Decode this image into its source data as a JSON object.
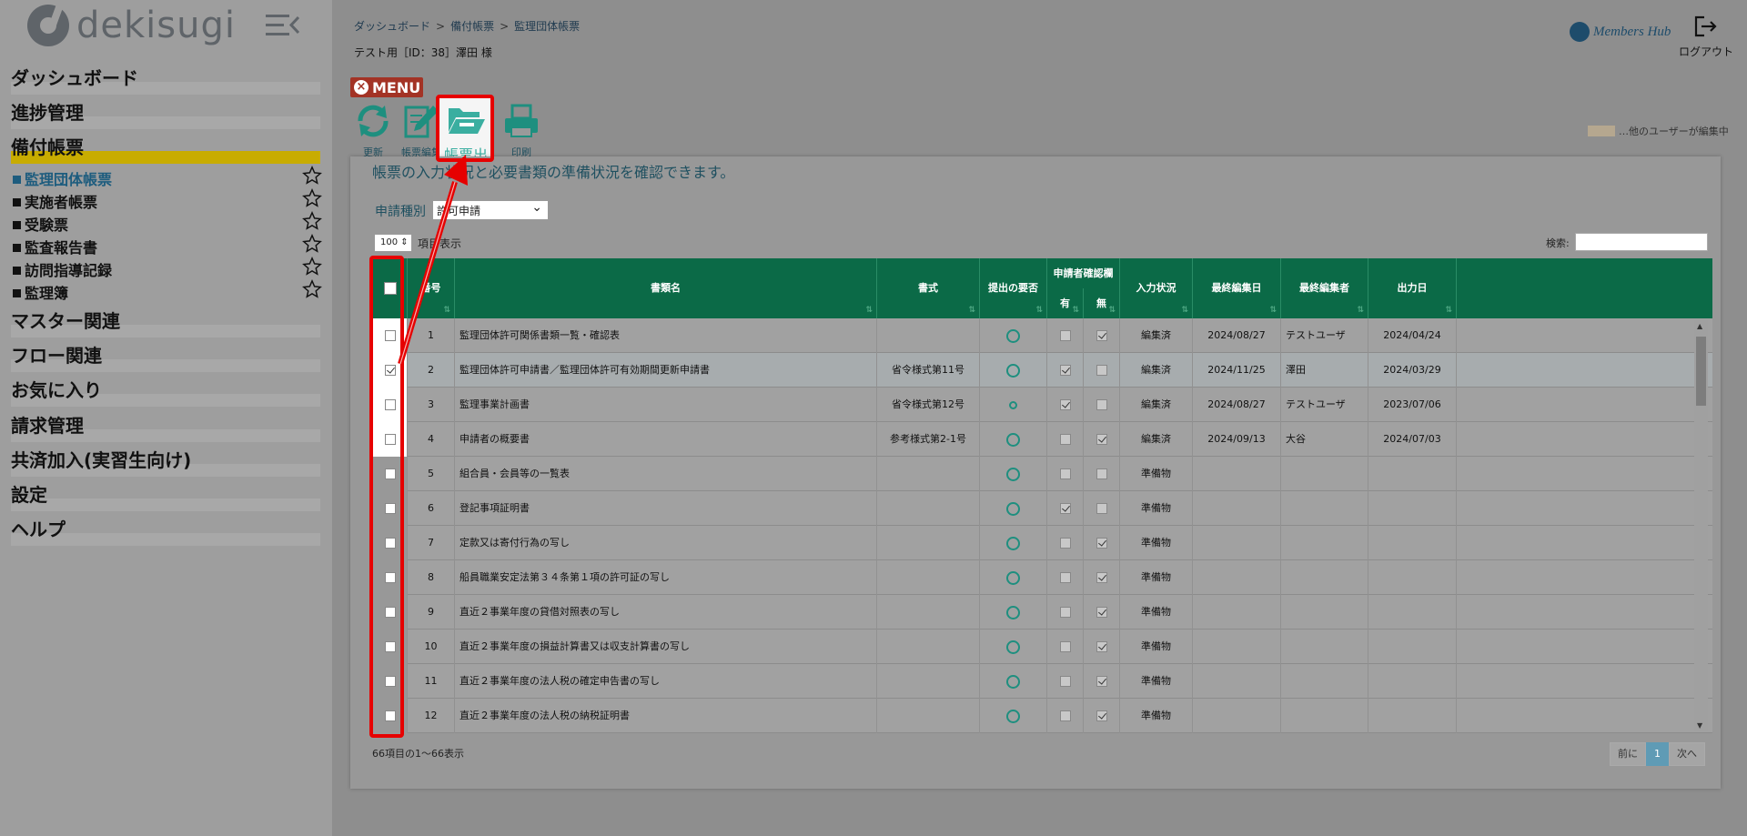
{
  "logo": {
    "text": "dekisugi"
  },
  "sidebar": {
    "sections": [
      {
        "label": "ダッシュボード"
      },
      {
        "label": "進捗管理"
      },
      {
        "label": "備付帳票"
      },
      {
        "label": "マスター関連"
      },
      {
        "label": "フロー関連"
      },
      {
        "label": "お気に入り"
      },
      {
        "label": "請求管理"
      },
      {
        "label": "共済加入(実習生向け)"
      },
      {
        "label": "設定"
      },
      {
        "label": "ヘルプ"
      }
    ],
    "sub_items": [
      {
        "label": "監理団体帳票"
      },
      {
        "label": "実施者帳票"
      },
      {
        "label": "受験票"
      },
      {
        "label": "監査報告書"
      },
      {
        "label": "訪問指導記録"
      },
      {
        "label": "監理簿"
      }
    ]
  },
  "header": {
    "breadcrumb": [
      "ダッシュボード",
      "備付帳票",
      "監理団体帳票"
    ],
    "breadcrumb_sep": ">",
    "user": "テスト用［ID：38］澤田 様",
    "members_hub": "Members Hub",
    "logout": "ログアウト"
  },
  "toolbar": {
    "menu": "MENU",
    "refresh": "更新",
    "edit": "帳票編集",
    "output": "帳票出力",
    "print": "印刷"
  },
  "legend": {
    "editing": "…他のユーザーが編集中"
  },
  "panel": {
    "description": "帳票の入力状況と必要書類の準備状況を確認できます。",
    "type_label": "申請種別",
    "type_value": "許可申請",
    "length_value": "100",
    "length_label": "項目表示",
    "search_label": "検索:",
    "info": "66項目の1～66表示",
    "pager": {
      "prev": "前に",
      "current": "1",
      "next": "次へ"
    }
  },
  "table": {
    "headers": {
      "no": "番号",
      "name": "書類名",
      "format": "書式",
      "submit": "提出の要否",
      "confirm": "申請者確認欄",
      "confirm_yes": "有",
      "confirm_no": "無",
      "status": "入力状況",
      "last_date": "最終編集日",
      "last_editor": "最終編集者",
      "out_date": "出力日"
    },
    "rows": [
      {
        "no": "1",
        "name": "監理団体許可関係書類一覧・確認表",
        "format": "",
        "ring": "full",
        "yes": false,
        "no_chk": true,
        "status": "編集済",
        "last_date": "2024/08/27",
        "editor": "テストユーザ",
        "out_date": "2024/04/24",
        "sel": false,
        "white": true
      },
      {
        "no": "2",
        "name": "監理団体許可申請書／監理団体許可有効期間更新申請書",
        "format": "省令様式第11号",
        "ring": "full",
        "yes": true,
        "no_chk": false,
        "status": "編集済",
        "last_date": "2024/11/25",
        "editor": "澤田",
        "out_date": "2024/03/29",
        "sel": true,
        "white": true
      },
      {
        "no": "3",
        "name": "監理事業計画書",
        "format": "省令様式第12号",
        "ring": "small",
        "yes": true,
        "no_chk": false,
        "status": "編集済",
        "last_date": "2024/08/27",
        "editor": "テストユーザ",
        "out_date": "2023/07/06",
        "sel": false,
        "white": true
      },
      {
        "no": "4",
        "name": "申請者の概要書",
        "format": "参考様式第2-1号",
        "ring": "full",
        "yes": false,
        "no_chk": true,
        "status": "編集済",
        "last_date": "2024/09/13",
        "editor": "大谷",
        "out_date": "2024/07/03",
        "sel": false,
        "white": true
      },
      {
        "no": "5",
        "name": "組合員・会員等の一覧表",
        "format": "",
        "ring": "full",
        "yes": false,
        "no_chk": false,
        "status": "準備物",
        "last_date": "",
        "editor": "",
        "out_date": "",
        "sel": false,
        "white": false
      },
      {
        "no": "6",
        "name": "登記事項証明書",
        "format": "",
        "ring": "full",
        "yes": true,
        "no_chk": false,
        "status": "準備物",
        "last_date": "",
        "editor": "",
        "out_date": "",
        "sel": false,
        "white": false
      },
      {
        "no": "7",
        "name": "定款又は寄付行為の写し",
        "format": "",
        "ring": "full",
        "yes": false,
        "no_chk": true,
        "status": "準備物",
        "last_date": "",
        "editor": "",
        "out_date": "",
        "sel": false,
        "white": false
      },
      {
        "no": "8",
        "name": "船員職業安定法第３４条第１項の許可証の写し",
        "format": "",
        "ring": "full",
        "yes": false,
        "no_chk": true,
        "status": "準備物",
        "last_date": "",
        "editor": "",
        "out_date": "",
        "sel": false,
        "white": false
      },
      {
        "no": "9",
        "name": "直近２事業年度の貸借対照表の写し",
        "format": "",
        "ring": "full",
        "yes": false,
        "no_chk": true,
        "status": "準備物",
        "last_date": "",
        "editor": "",
        "out_date": "",
        "sel": false,
        "white": false
      },
      {
        "no": "10",
        "name": "直近２事業年度の損益計算書又は収支計算書の写し",
        "format": "",
        "ring": "full",
        "yes": false,
        "no_chk": true,
        "status": "準備物",
        "last_date": "",
        "editor": "",
        "out_date": "",
        "sel": false,
        "white": false
      },
      {
        "no": "11",
        "name": "直近２事業年度の法人税の確定申告書の写し",
        "format": "",
        "ring": "full",
        "yes": false,
        "no_chk": true,
        "status": "準備物",
        "last_date": "",
        "editor": "",
        "out_date": "",
        "sel": false,
        "white": false
      },
      {
        "no": "12",
        "name": "直近２事業年度の法人税の納税証明書",
        "format": "",
        "ring": "full",
        "yes": false,
        "no_chk": true,
        "status": "準備物",
        "last_date": "",
        "editor": "",
        "out_date": "",
        "sel": false,
        "white": false
      }
    ]
  },
  "colors": {
    "header_green": "#0b6a47",
    "accent_red": "#e60000",
    "active_bar": "#c8ac00"
  }
}
